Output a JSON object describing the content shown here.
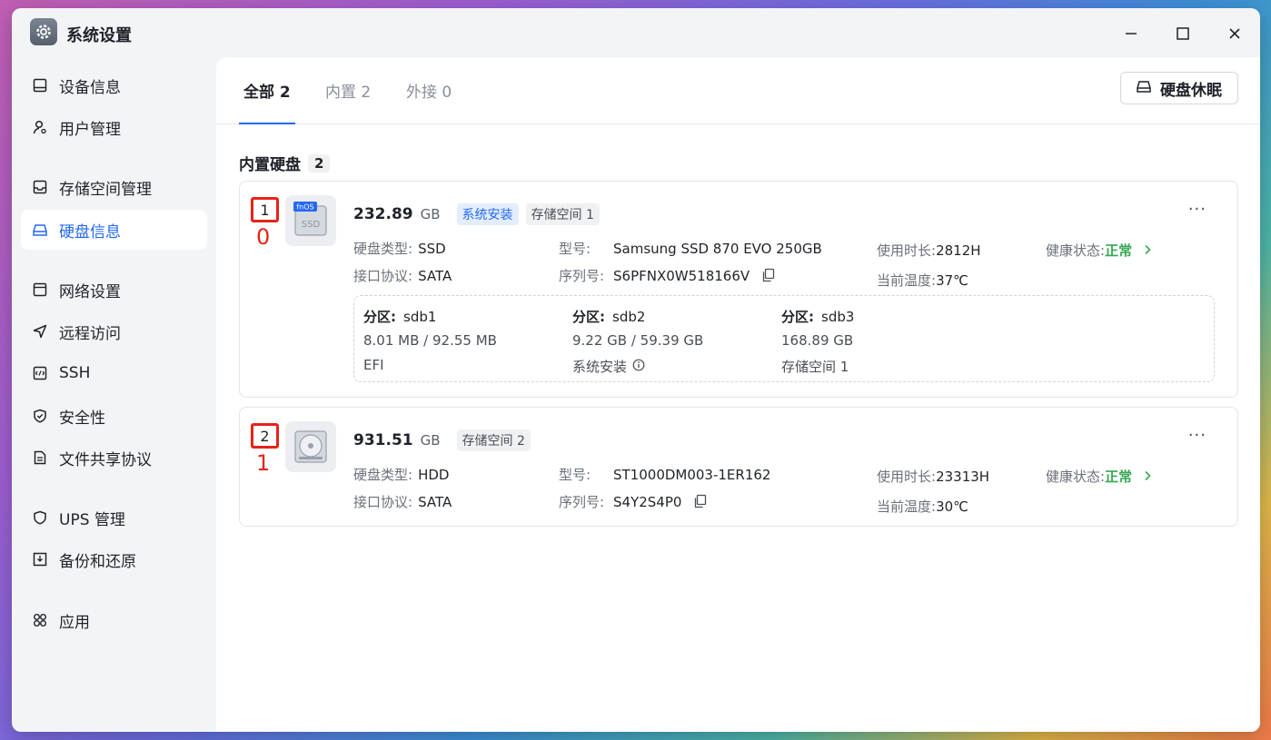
{
  "window": {
    "title": "系统设置"
  },
  "sidebar": {
    "items": [
      {
        "label": "设备信息",
        "icon": "device-icon"
      },
      {
        "label": "用户管理",
        "icon": "user-icon"
      },
      {
        "label": "存储空间管理",
        "icon": "storage-icon"
      },
      {
        "label": "硬盘信息",
        "icon": "disk-icon",
        "active": true
      },
      {
        "label": "网络设置",
        "icon": "network-icon"
      },
      {
        "label": "远程访问",
        "icon": "remote-icon"
      },
      {
        "label": "SSH",
        "icon": "ssh-icon"
      },
      {
        "label": "安全性",
        "icon": "shield-icon"
      },
      {
        "label": "文件共享协议",
        "icon": "file-share-icon"
      },
      {
        "label": "UPS 管理",
        "icon": "ups-icon"
      },
      {
        "label": "备份和还原",
        "icon": "backup-icon"
      },
      {
        "label": "应用",
        "icon": "apps-icon"
      }
    ]
  },
  "tabs": [
    {
      "label": "全部 2",
      "active": true
    },
    {
      "label": "内置 2"
    },
    {
      "label": "外接 0"
    }
  ],
  "sleep_button": {
    "label": "硬盘休眠"
  },
  "section": {
    "title": "内置硬盘",
    "count": "2"
  },
  "disks": [
    {
      "number": "1",
      "sub_label": "0",
      "icon_badge": "fnOS",
      "icon_text": "SSD",
      "capacity": "232.89",
      "unit": "GB",
      "tags": [
        "系统安装",
        "存储空间 1"
      ],
      "type_label": "硬盘类型:",
      "type_value": "SSD",
      "interface_label": "接口协议:",
      "interface_value": "SATA",
      "model_label": "型号:",
      "model_value": "Samsung SSD 870 EVO 250GB",
      "serial_label": "序列号:",
      "serial_value": "S6PFNX0W518166V",
      "hours_label": "使用时长:",
      "hours_value": "2812H",
      "temp_label": "当前温度:",
      "temp_value": "37℃",
      "health_label": "健康状态:",
      "health_value": "正常",
      "partitions": [
        {
          "label": "分区:",
          "name": "sdb1",
          "size": "8.01 MB / 92.55 MB",
          "use": "EFI"
        },
        {
          "label": "分区:",
          "name": "sdb2",
          "size": "9.22 GB / 59.39 GB",
          "use": "系统安装"
        },
        {
          "label": "分区:",
          "name": "sdb3",
          "size": "168.89 GB",
          "use": "存储空间 1"
        }
      ]
    },
    {
      "number": "2",
      "sub_label": "1",
      "capacity": "931.51",
      "unit": "GB",
      "tags": [
        "存储空间 2"
      ],
      "type_label": "硬盘类型:",
      "type_value": "HDD",
      "interface_label": "接口协议:",
      "interface_value": "SATA",
      "model_label": "型号:",
      "model_value": "ST1000DM003-1ER162",
      "serial_label": "序列号:",
      "serial_value": "S4Y2S4P0",
      "hours_label": "使用时长:",
      "hours_value": "23313H",
      "temp_label": "当前温度:",
      "temp_value": "30℃",
      "health_label": "健康状态:",
      "health_value": "正常"
    }
  ],
  "colors": {
    "accent": "#2468f2",
    "health": "#36a852",
    "highlight": "#e5241a"
  }
}
